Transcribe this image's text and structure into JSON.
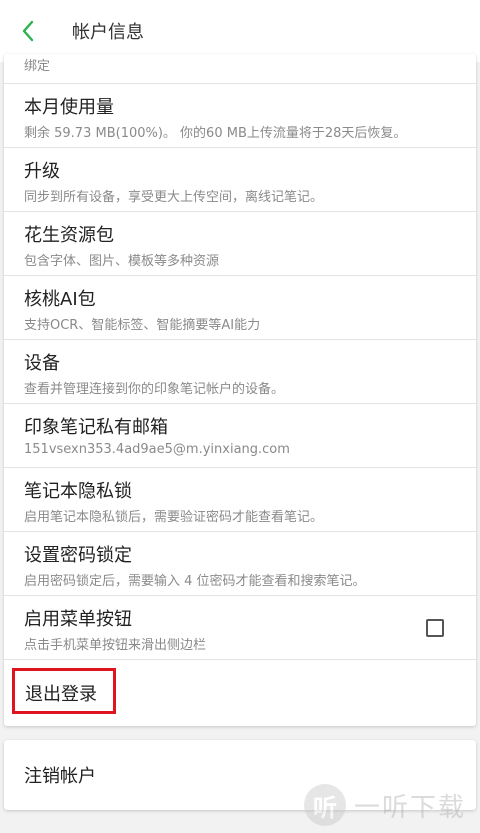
{
  "header": {
    "title": "帐户信息"
  },
  "partial_item": {
    "subtitle": "绑定"
  },
  "items": [
    {
      "title": "本月使用量",
      "subtitle": "剩余 59.73 MB(100%)。 你的60 MB上传流量将于28天后恢复。"
    },
    {
      "title": "升级",
      "subtitle": "同步到所有设备，享受更大上传空间，离线记笔记。"
    },
    {
      "title": "花生资源包",
      "subtitle": "包含字体、图片、模板等多种资源"
    },
    {
      "title": "核桃AI包",
      "subtitle": "支持OCR、智能标签、智能摘要等AI能力"
    },
    {
      "title": "设备",
      "subtitle": "查看并管理连接到你的印象笔记帐户的设备。"
    },
    {
      "title": "印象笔记私有邮箱",
      "subtitle": "151vsexn353.4ad9ae5@m.yinxiang.com"
    },
    {
      "title": "笔记本隐私锁",
      "subtitle": "启用笔记本隐私锁后，需要验证密码才能查看笔记。"
    },
    {
      "title": "设置密码锁定",
      "subtitle": "启用密码锁定后，需要输入 4 位密码才能查看和搜索笔记。"
    },
    {
      "title": "启用菜单按钮",
      "subtitle": "点击手机菜单按钮来滑出侧边栏"
    }
  ],
  "logout": {
    "label": "退出登录"
  },
  "deactivate": {
    "label": "注销帐户"
  },
  "watermark": {
    "logo_glyph": "听",
    "text": "一听下载"
  },
  "colors": {
    "accent_green": "#2bb24c",
    "highlight_red": "#e0141e"
  }
}
